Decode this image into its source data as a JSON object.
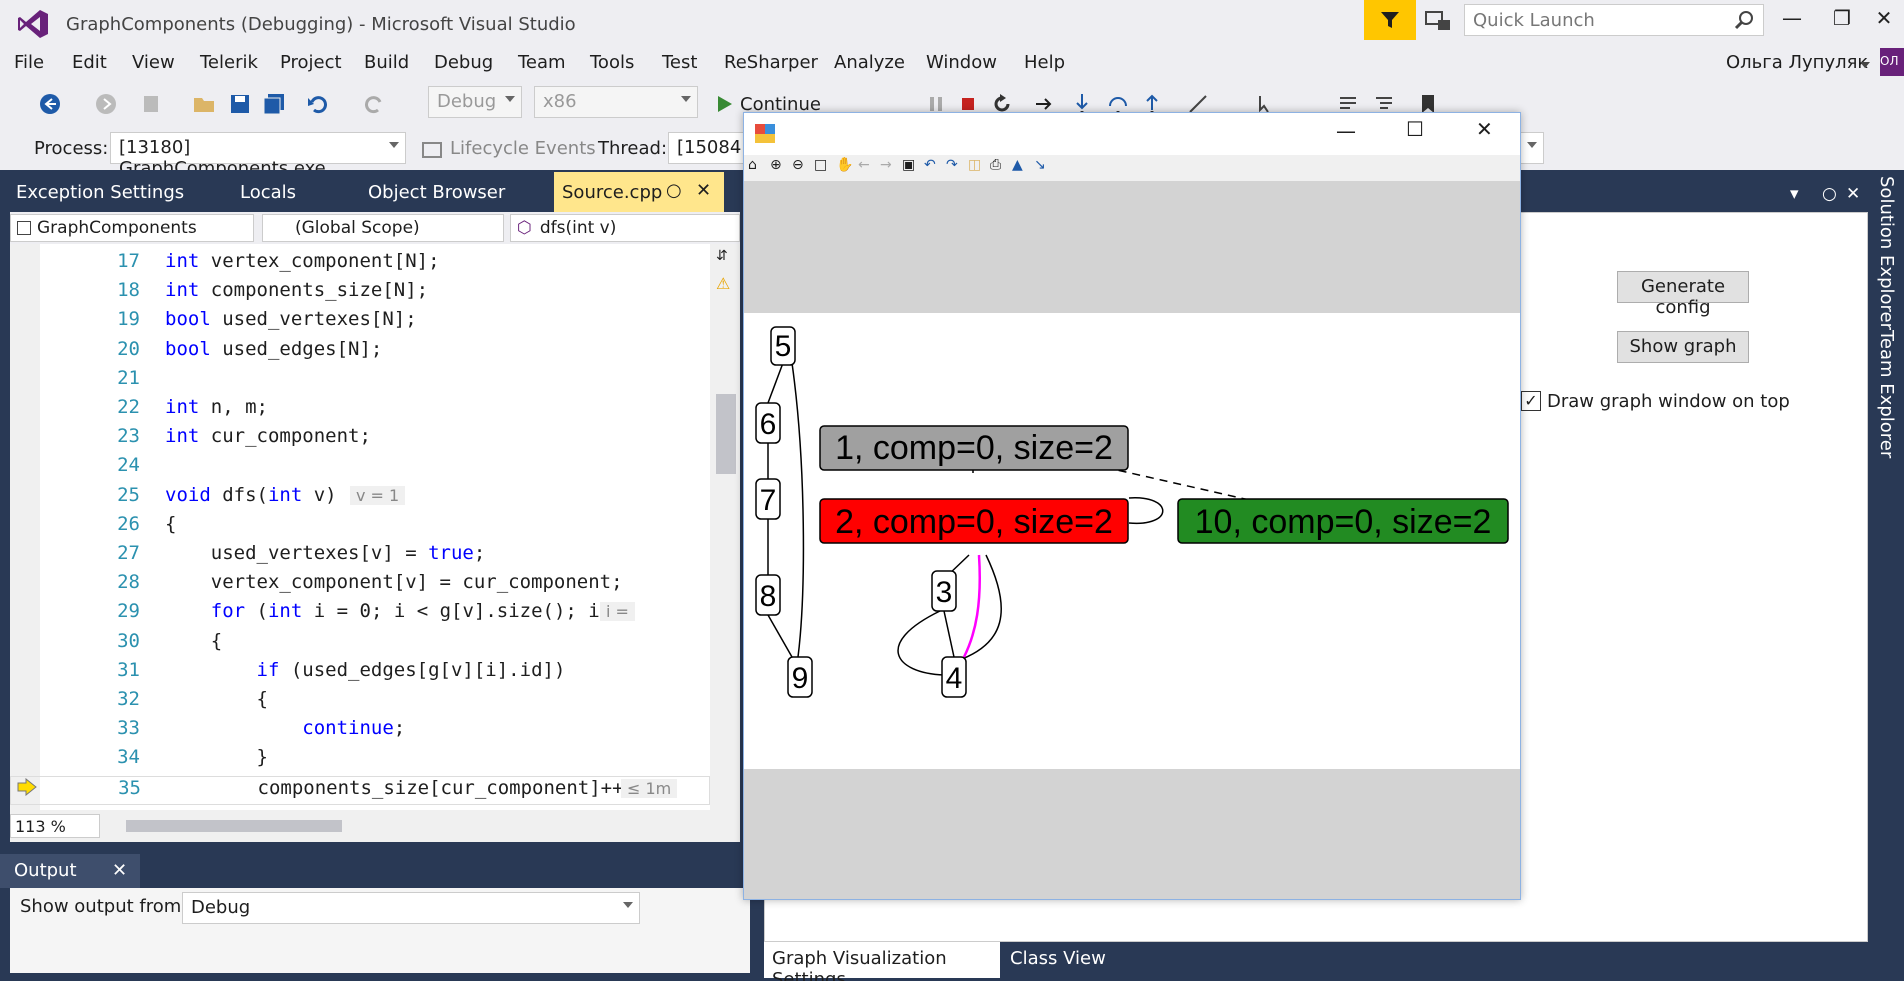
{
  "window": {
    "title": "GraphComponents (Debugging) - Microsoft Visual Studio"
  },
  "quick_launch": {
    "placeholder": "Quick Launch"
  },
  "menu": [
    "File",
    "Edit",
    "View",
    "Telerik",
    "Project",
    "Build",
    "Debug",
    "Team",
    "Tools",
    "Test",
    "ReSharper",
    "Analyze",
    "Window",
    "Help"
  ],
  "user": {
    "name": "Ольга Лупуляк",
    "initials": "ОЛ"
  },
  "toolbar": {
    "config": "Debug",
    "platform": "x86",
    "continue_label": "Continue",
    "process_label": "Process:",
    "process_value": "[13180] GraphComponents.exe",
    "lifecycle_label": "Lifecycle Events",
    "thread_label": "Thread:",
    "thread_value": "[15084] "
  },
  "doc_tabs": [
    "Exception Settings",
    "Locals",
    "Object Browser"
  ],
  "active_tab": "Source.cpp",
  "nav": {
    "project": "GraphComponents",
    "scope": "(Global Scope)",
    "member": "dfs(int v)"
  },
  "code_lines": [
    {
      "n": "17",
      "text": "int vertex_component[N];"
    },
    {
      "n": "18",
      "text": "int components_size[N];"
    },
    {
      "n": "19",
      "text": "bool used_vertexes[N];"
    },
    {
      "n": "20",
      "text": "bool used_edges[N];"
    },
    {
      "n": "21",
      "text": ""
    },
    {
      "n": "22",
      "text": "int n, m;"
    },
    {
      "n": "23",
      "text": "int cur_component;"
    },
    {
      "n": "24",
      "text": ""
    },
    {
      "n": "25",
      "text": "void dfs(int v)"
    },
    {
      "n": "26",
      "text": "{"
    },
    {
      "n": "27",
      "text": "    used_vertexes[v] = true;"
    },
    {
      "n": "28",
      "text": "    vertex_component[v] = cur_component;"
    },
    {
      "n": "29",
      "text": "    for (int i = 0; i < g[v].size(); i++)"
    },
    {
      "n": "30",
      "text": "    {"
    },
    {
      "n": "31",
      "text": "        if (used_edges[g[v][i].id])"
    },
    {
      "n": "32",
      "text": "        {"
    },
    {
      "n": "33",
      "text": "            continue;"
    },
    {
      "n": "34",
      "text": "        }"
    },
    {
      "n": "35",
      "text": "        components_size[cur_component]++;"
    }
  ],
  "hints": {
    "v": "v = 1",
    "i": "i =",
    "time": "≤ 1m"
  },
  "zoom": "113 %",
  "output": {
    "title": "Output",
    "show_from_label": "Show output from:",
    "source": "Debug"
  },
  "settings": {
    "generate_label": "Generate config",
    "show_label": "Show graph",
    "checkbox_label": "Draw graph window on top",
    "checkbox_checked": true
  },
  "bottom_tabs": [
    "Graph Visualization Settings",
    "Class View"
  ],
  "side_tabs": [
    "Solution Explorer",
    "Team Explorer"
  ],
  "graph": {
    "nodes": {
      "n5": "5",
      "n6": "6",
      "n7": "7",
      "n8": "8",
      "n9": "9",
      "n3": "3",
      "n4": "4",
      "c1": "1, comp=0, size=2",
      "c2": "2, comp=0, size=2",
      "c10": "10, comp=0, size=2"
    },
    "colors": {
      "c1": "#a0a0a0",
      "c2": "#ff0000",
      "c10": "#228b22",
      "edge_highlight": "#ff00ff"
    }
  }
}
